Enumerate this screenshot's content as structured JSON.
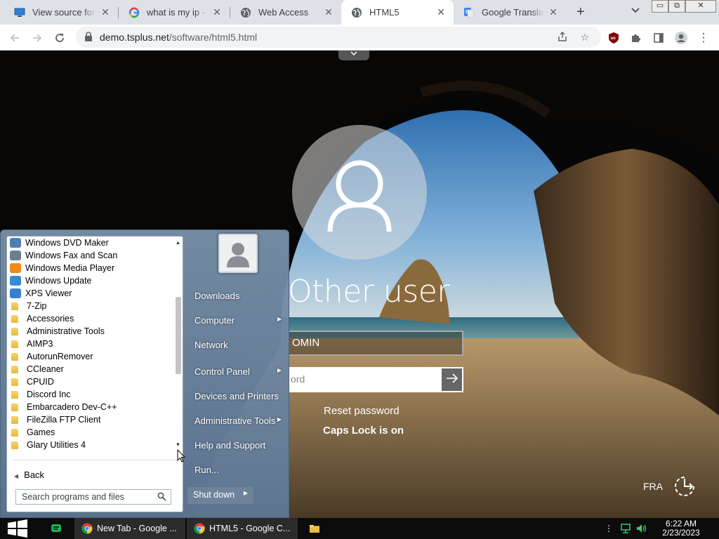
{
  "browser": {
    "tabs": [
      {
        "title": "View source for",
        "icon": "monitor-icon"
      },
      {
        "title": "what is my ip - G",
        "icon": "google-icon"
      },
      {
        "title": "Web Access",
        "icon": "globe-icon"
      },
      {
        "title": "HTML5",
        "icon": "globe-icon",
        "active": true
      },
      {
        "title": "Google Translate",
        "icon": "translate-icon"
      }
    ],
    "url_host": "demo.tsplus.net",
    "url_path": "/software/html5.html",
    "window_controls": [
      "▭",
      "⧉",
      "✕"
    ]
  },
  "login": {
    "username": "Other user",
    "user_field_value": "OMIN",
    "password_placeholder": "ord",
    "reset_link": "Reset password",
    "caps_lock_message": "Caps Lock is on",
    "language": "FRA"
  },
  "startmenu": {
    "programs": [
      {
        "label": "Windows DVD Maker",
        "kind": "app",
        "color": "#4d7fb5"
      },
      {
        "label": "Windows Fax and Scan",
        "kind": "app",
        "color": "#6a7f95"
      },
      {
        "label": "Windows Media Player",
        "kind": "app",
        "color": "#f08a1c"
      },
      {
        "label": "Windows Update",
        "kind": "app",
        "color": "#3a8ad3"
      },
      {
        "label": "XPS Viewer",
        "kind": "app",
        "color": "#3a7fc9"
      },
      {
        "label": "7-Zip",
        "kind": "folder"
      },
      {
        "label": "Accessories",
        "kind": "folder"
      },
      {
        "label": "Administrative Tools",
        "kind": "folder"
      },
      {
        "label": "AIMP3",
        "kind": "folder"
      },
      {
        "label": "AutorunRemover",
        "kind": "folder"
      },
      {
        "label": "CCleaner",
        "kind": "folder"
      },
      {
        "label": "CPUID",
        "kind": "folder"
      },
      {
        "label": "Discord Inc",
        "kind": "folder"
      },
      {
        "label": "Embarcadero Dev-C++",
        "kind": "folder"
      },
      {
        "label": "FileZilla FTP Client",
        "kind": "folder"
      },
      {
        "label": "Games",
        "kind": "folder"
      },
      {
        "label": "Glary Utilities 4",
        "kind": "folder"
      }
    ],
    "back_label": "Back",
    "search_placeholder": "Search programs and files",
    "right_items": [
      {
        "label": "Downloads",
        "submenu": false
      },
      {
        "label": "Computer",
        "submenu": true
      },
      {
        "label": "Network",
        "submenu": false
      },
      {
        "label": "Control Panel",
        "submenu": true
      },
      {
        "label": "Devices and Printers",
        "submenu": false
      },
      {
        "label": "Administrative Tools",
        "submenu": true
      },
      {
        "label": "Help and Support",
        "submenu": false
      },
      {
        "label": "Run...",
        "submenu": false
      }
    ],
    "shutdown_label": "Shut down"
  },
  "taskbar": {
    "apps": [
      {
        "label": "New Tab - Google ...",
        "icon": "chrome-icon"
      },
      {
        "label": "HTML5 - Google C...",
        "icon": "chrome-icon"
      }
    ],
    "time": "6:22 AM",
    "date": "2/23/2023"
  }
}
